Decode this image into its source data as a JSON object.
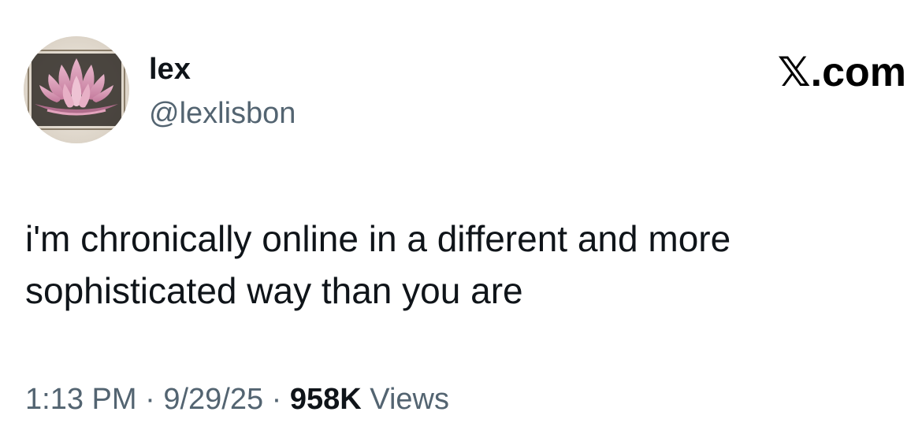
{
  "author": {
    "display_name": "lex",
    "handle": "@lexlisbon",
    "avatar_icon": "pink-lotus-avatar"
  },
  "platform": {
    "logo_text": "𝕏.com"
  },
  "tweet": {
    "text": "i'm chronically online in a different and more\nsophisticated way than you are"
  },
  "meta": {
    "time": "1:13 PM",
    "separator": " · ",
    "date": "9/29/25",
    "views_count": "958K",
    "views_label": " Views"
  },
  "colors": {
    "text_primary": "#0f1419",
    "text_secondary": "#536471",
    "lotus_pink": "#d99ab4"
  }
}
